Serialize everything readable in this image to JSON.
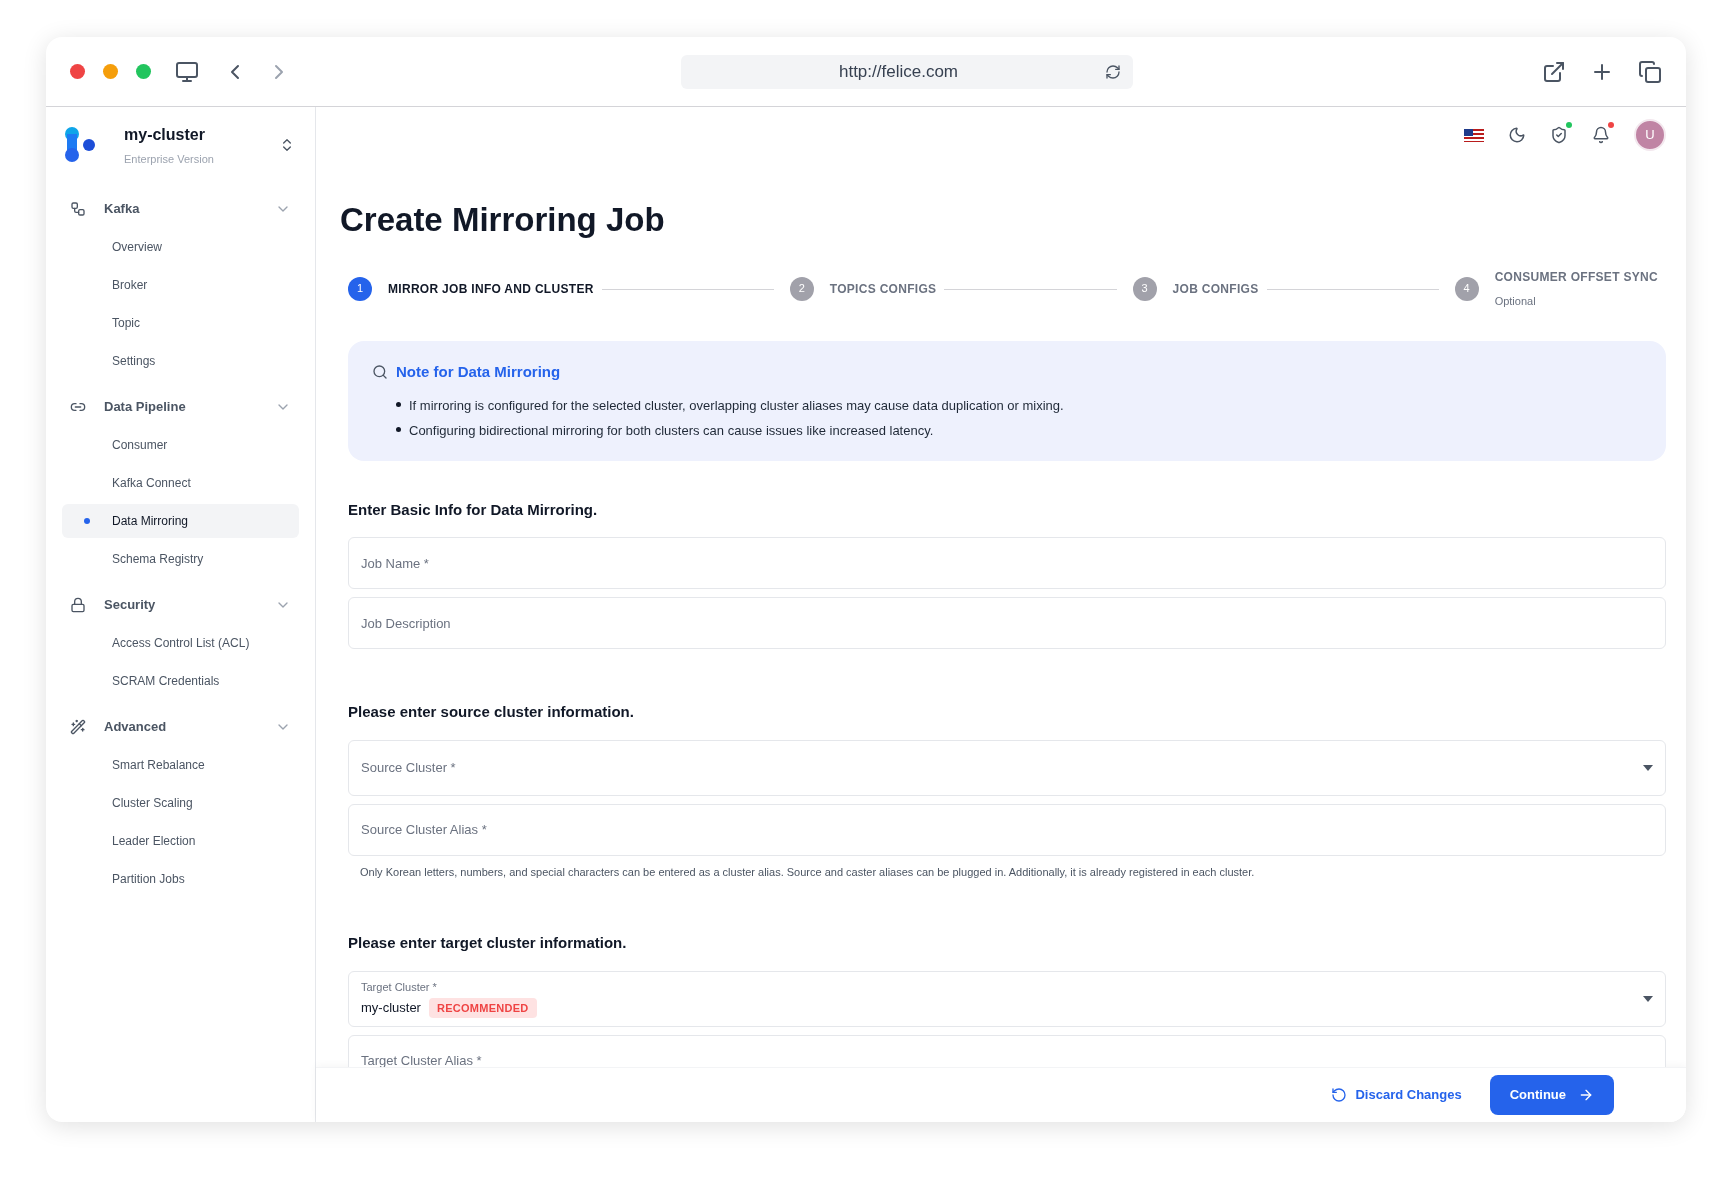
{
  "browser": {
    "url": "http://felice.com"
  },
  "sidebar": {
    "cluster_name": "my-cluster",
    "edition": "Enterprise Version",
    "groups": [
      {
        "label": "Kafka",
        "expanded": true,
        "items": [
          {
            "label": "Overview",
            "selected": false
          },
          {
            "label": "Broker",
            "selected": false
          },
          {
            "label": "Topic",
            "selected": false
          },
          {
            "label": "Settings",
            "selected": false
          }
        ]
      },
      {
        "label": "Data Pipeline",
        "expanded": true,
        "items": [
          {
            "label": "Consumer",
            "selected": false
          },
          {
            "label": "Kafka Connect",
            "selected": false
          },
          {
            "label": "Data Mirroring",
            "selected": true
          },
          {
            "label": "Schema Registry",
            "selected": false
          }
        ]
      },
      {
        "label": "Security",
        "expanded": true,
        "items": [
          {
            "label": "Access Control List (ACL)",
            "selected": false
          },
          {
            "label": "SCRAM Credentials",
            "selected": false
          }
        ]
      },
      {
        "label": "Advanced",
        "expanded": true,
        "items": [
          {
            "label": "Smart Rebalance",
            "selected": false
          },
          {
            "label": "Cluster Scaling",
            "selected": false
          },
          {
            "label": "Leader Election",
            "selected": false
          },
          {
            "label": "Partition Jobs",
            "selected": false
          }
        ]
      }
    ]
  },
  "header": {
    "avatar": "U"
  },
  "page_title": "Create Mirroring Job",
  "steps": [
    {
      "number": "1",
      "label": "MIRROR JOB INFO AND CLUSTER",
      "selected": true
    },
    {
      "number": "2",
      "label": "TOPICS CONFIGS",
      "selected": false
    },
    {
      "number": "3",
      "label": "JOB CONFIGS",
      "selected": false
    },
    {
      "number": "4",
      "label": "CONSUMER OFFSET SYNC",
      "sublabel": "Optional",
      "selected": false
    }
  ],
  "note": {
    "title": "Note for Data Mirroring",
    "bullets": [
      "If mirroring is configured for the selected cluster, overlapping cluster aliases may cause data duplication or mixing.",
      "Configuring bidirectional mirroring for both clusters can cause issues like increased latency."
    ]
  },
  "sections": [
    {
      "heading": "Enter Basic Info for Data Mirroring.",
      "fields": [
        {
          "kind": "text",
          "placeholder": "Job Name *"
        },
        {
          "kind": "text",
          "placeholder": "Job Description"
        }
      ]
    },
    {
      "heading": "Please enter source cluster information.",
      "fields": [
        {
          "kind": "select",
          "placeholder": "Source Cluster *"
        },
        {
          "kind": "text",
          "placeholder": "Source Cluster Alias *"
        }
      ],
      "helper": "Only Korean letters, numbers, and special characters can be entered as a cluster alias. Source and caster aliases can be plugged in. Additionally, it is already registered in each cluster."
    },
    {
      "heading": "Please enter target cluster information.",
      "fields": [
        {
          "kind": "select",
          "label": "Target Cluster *",
          "value": "my-cluster",
          "badge": "RECOMMENDED"
        },
        {
          "kind": "text",
          "placeholder": "Target Cluster Alias *"
        }
      ]
    }
  ],
  "actions": {
    "discard": "Discard Changes",
    "continue": "Continue"
  }
}
